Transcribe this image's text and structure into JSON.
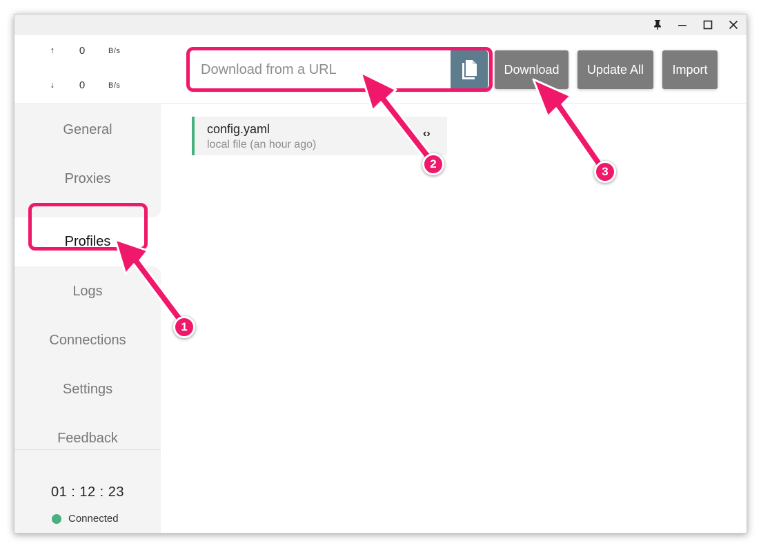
{
  "titlebar": {
    "pin_icon": "pin-icon",
    "minimize_icon": "minimize-icon",
    "maximize_icon": "maximize-icon",
    "close_icon": "close-icon"
  },
  "traffic": {
    "upload": {
      "arrow": "↑",
      "value": "0",
      "unit": "B/s"
    },
    "download": {
      "arrow": "↓",
      "value": "0",
      "unit": "B/s"
    }
  },
  "sidebar": {
    "items": [
      {
        "label": "General"
      },
      {
        "label": "Proxies"
      },
      {
        "label": "Profiles",
        "active": true
      },
      {
        "label": "Logs"
      },
      {
        "label": "Connections"
      },
      {
        "label": "Settings"
      },
      {
        "label": "Feedback"
      }
    ],
    "timer": "01 : 12 : 23",
    "status": "Connected",
    "status_color": "#47b17e"
  },
  "toolbar": {
    "url_placeholder": "Download from a URL",
    "paste_icon": "paste-icon",
    "download_label": "Download",
    "update_all_label": "Update All",
    "import_label": "Import"
  },
  "profiles": [
    {
      "name": "config.yaml",
      "meta": "local file (an hour ago)",
      "edit_icon": "code-icon"
    }
  ],
  "annotations": {
    "color": "#f0186a",
    "badges": [
      "1",
      "2",
      "3"
    ]
  }
}
